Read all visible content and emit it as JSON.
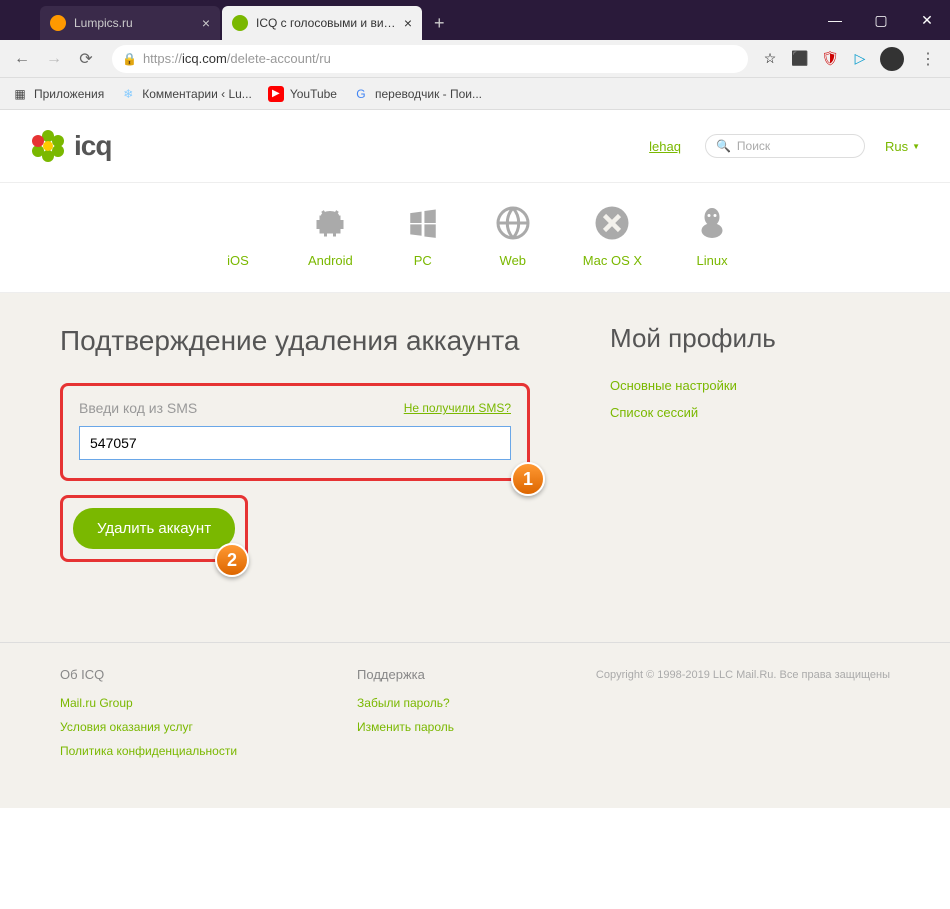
{
  "browser": {
    "tabs": [
      {
        "title": "Lumpics.ru",
        "active": false
      },
      {
        "title": "ICQ с голосовыми и видеозвон",
        "active": true
      }
    ],
    "url_prefix": "https://",
    "url_domain": "icq.com",
    "url_path": "/delete-account/ru",
    "bookmarks": [
      {
        "label": "Приложения"
      },
      {
        "label": "Комментарии ‹ Lu..."
      },
      {
        "label": "YouTube"
      },
      {
        "label": "переводчик - Пои..."
      }
    ]
  },
  "header": {
    "logo_text": "icq",
    "user_link": "lehaq",
    "search_placeholder": "Поиск",
    "language": "Rus"
  },
  "platforms": [
    {
      "name": "iOS"
    },
    {
      "name": "Android"
    },
    {
      "name": "PC"
    },
    {
      "name": "Web"
    },
    {
      "name": "Mac OS X"
    },
    {
      "name": "Linux"
    }
  ],
  "main": {
    "heading": "Подтверждение удаления аккаунта",
    "field_label": "Введи код из SMS",
    "sms_link": "Не получили SMS?",
    "code_value": "547057",
    "delete_button": "Удалить аккаунт"
  },
  "sidebar": {
    "heading": "Мой профиль",
    "links": [
      "Основные настройки",
      "Список сессий"
    ]
  },
  "footer": {
    "col1_title": "Об ICQ",
    "col1_links": [
      "Mail.ru Group",
      "Условия оказания услуг",
      "Политика конфиденциальности"
    ],
    "col2_title": "Поддержка",
    "col2_links": [
      "Забыли пароль?",
      "Изменить пароль"
    ],
    "copyright": "Copyright © 1998-2019 LLC Mail.Ru. Все права защищены"
  },
  "annotations": {
    "badge1": "1",
    "badge2": "2"
  }
}
